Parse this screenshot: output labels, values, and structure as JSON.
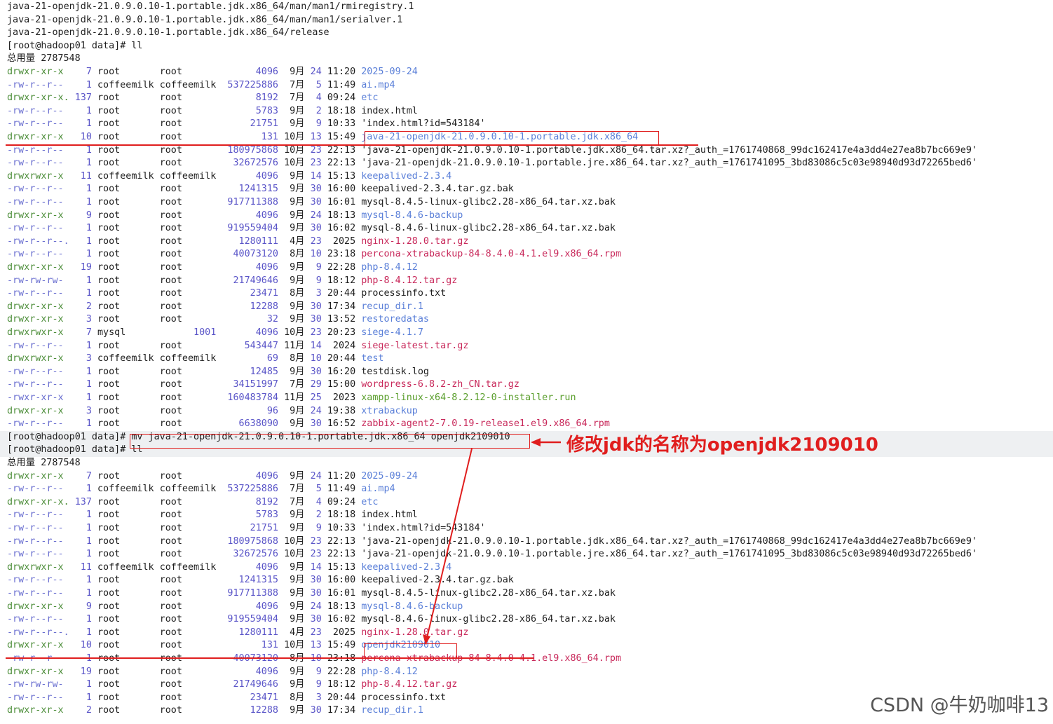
{
  "terminal": {
    "header_lines": [
      "java-21-openjdk-21.0.9.0.10-1.portable.jdk.x86_64/man/man1/rmiregistry.1",
      "java-21-openjdk-21.0.9.0.10-1.portable.jdk.x86_64/man/man1/serialver.1",
      "java-21-openjdk-21.0.9.0.10-1.portable.jdk.x86_64/release"
    ],
    "prompt1": "[root@hadoop01 data]#",
    "cmd1": " ll",
    "total1": "总用量 2787548",
    "listing1": [
      {
        "perm": "drwxr-xr-x ",
        "links": "  7",
        "user": "root      ",
        "group": "root      ",
        "size": "      4096",
        "mon": " 9月",
        "day": "24",
        "time": "11:20",
        "name": "2025-09-24",
        "cls": "c-dir"
      },
      {
        "perm": "-rw-r--r-- ",
        "links": "  1",
        "user": "coffeemilk",
        "group": "coffeemilk",
        "size": " 537225886",
        "mon": " 7月",
        "day": " 5",
        "time": "11:49",
        "name": "ai.mp4",
        "cls": "c-dir"
      },
      {
        "perm": "drwxr-xr-x.",
        "links": "137",
        "user": "root      ",
        "group": "root      ",
        "size": "      8192",
        "mon": " 7月",
        "day": " 4",
        "time": "09:24",
        "name": "etc",
        "cls": "c-dir"
      },
      {
        "perm": "-rw-r--r-- ",
        "links": "  1",
        "user": "root      ",
        "group": "root      ",
        "size": "      5783",
        "mon": " 9月",
        "day": " 2",
        "time": "18:18",
        "name": "index.html",
        "cls": "c-file"
      },
      {
        "perm": "-rw-r--r-- ",
        "links": "  1",
        "user": "root      ",
        "group": "root      ",
        "size": "     21751",
        "mon": " 9月",
        "day": " 9",
        "time": "10:33",
        "name": "'index.html?id=543184'",
        "cls": "c-file"
      },
      {
        "perm": "drwxr-xr-x ",
        "links": " 10",
        "user": "root      ",
        "group": "root      ",
        "size": "       131",
        "mon": "10月",
        "day": "13",
        "time": "15:49",
        "name": "java-21-openjdk-21.0.9.0.10-1.portable.jdk.x86_64",
        "cls": "c-dir"
      },
      {
        "perm": "-rw-r--r-- ",
        "links": "  1",
        "user": "root      ",
        "group": "root      ",
        "size": " 180975868",
        "mon": "10月",
        "day": "23",
        "time": "22:13",
        "name": "'java-21-openjdk-21.0.9.0.10-1.portable.jdk.x86_64.tar.xz?_auth_=1761740868_99dc162417e4a3dd4e27ea8b7bc669e9'",
        "cls": "c-file"
      },
      {
        "perm": "-rw-r--r-- ",
        "links": "  1",
        "user": "root      ",
        "group": "root      ",
        "size": "  32672576",
        "mon": "10月",
        "day": "23",
        "time": "22:13",
        "name": "'java-21-openjdk-21.0.9.0.10-1.portable.jre.x86_64.tar.xz?_auth_=1761741095_3bd83086c5c03e98940d93d72265bed6'",
        "cls": "c-file"
      },
      {
        "perm": "drwxrwxr-x ",
        "links": " 11",
        "user": "coffeemilk",
        "group": "coffeemilk",
        "size": "      4096",
        "mon": " 9月",
        "day": "14",
        "time": "15:13",
        "name": "keepalived-2.3.4",
        "cls": "c-dir"
      },
      {
        "perm": "-rw-r--r-- ",
        "links": "  1",
        "user": "root      ",
        "group": "root      ",
        "size": "   1241315",
        "mon": " 9月",
        "day": "30",
        "time": "16:00",
        "name": "keepalived-2.3.4.tar.gz.bak",
        "cls": "c-file"
      },
      {
        "perm": "-rw-r--r-- ",
        "links": "  1",
        "user": "root      ",
        "group": "root      ",
        "size": " 917711388",
        "mon": " 9月",
        "day": "30",
        "time": "16:01",
        "name": "mysql-8.4.5-linux-glibc2.28-x86_64.tar.xz.bak",
        "cls": "c-file"
      },
      {
        "perm": "drwxr-xr-x ",
        "links": "  9",
        "user": "root      ",
        "group": "root      ",
        "size": "      4096",
        "mon": " 9月",
        "day": "24",
        "time": "18:13",
        "name": "mysql-8.4.6-backup",
        "cls": "c-dir"
      },
      {
        "perm": "-rw-r--r-- ",
        "links": "  1",
        "user": "root      ",
        "group": "root      ",
        "size": " 919559404",
        "mon": " 9月",
        "day": "30",
        "time": "16:02",
        "name": "mysql-8.4.6-linux-glibc2.28-x86_64.tar.xz.bak",
        "cls": "c-file"
      },
      {
        "perm": "-rw-r--r--.",
        "links": "  1",
        "user": "root      ",
        "group": "root      ",
        "size": "   1280111",
        "mon": " 4月",
        "day": "23",
        "time": " 2025",
        "name": "nginx-1.28.0.tar.gz",
        "cls": "c-arch"
      },
      {
        "perm": "-rw-r--r-- ",
        "links": "  1",
        "user": "root      ",
        "group": "root      ",
        "size": "  40073120",
        "mon": " 8月",
        "day": "10",
        "time": "23:18",
        "name": "percona-xtrabackup-84-8.4.0-4.1.el9.x86_64.rpm",
        "cls": "c-arch"
      },
      {
        "perm": "drwxr-xr-x ",
        "links": " 19",
        "user": "root      ",
        "group": "root      ",
        "size": "      4096",
        "mon": " 9月",
        "day": " 9",
        "time": "22:28",
        "name": "php-8.4.12",
        "cls": "c-dir"
      },
      {
        "perm": "-rw-rw-rw- ",
        "links": "  1",
        "user": "root      ",
        "group": "root      ",
        "size": "  21749646",
        "mon": " 9月",
        "day": " 9",
        "time": "18:12",
        "name": "php-8.4.12.tar.gz",
        "cls": "c-arch"
      },
      {
        "perm": "-rw-r--r-- ",
        "links": "  1",
        "user": "root      ",
        "group": "root      ",
        "size": "     23471",
        "mon": " 8月",
        "day": " 3",
        "time": "20:44",
        "name": "processinfo.txt",
        "cls": "c-file"
      },
      {
        "perm": "drwxr-xr-x ",
        "links": "  2",
        "user": "root      ",
        "group": "root      ",
        "size": "     12288",
        "mon": " 9月",
        "day": "30",
        "time": "17:34",
        "name": "recup_dir.1",
        "cls": "c-dir"
      },
      {
        "perm": "drwxr-xr-x ",
        "links": "  3",
        "user": "root      ",
        "group": "root      ",
        "size": "        32",
        "mon": " 9月",
        "day": "30",
        "time": "13:52",
        "name": "restoredatas",
        "cls": "c-dir"
      },
      {
        "perm": "drwxrwxr-x ",
        "links": "  7",
        "user": "mysql     ",
        "group": "      1001",
        "size": "      4096",
        "mon": "10月",
        "day": "23",
        "time": "20:23",
        "name": "siege-4.1.7",
        "cls": "c-dir"
      },
      {
        "perm": "-rw-r--r-- ",
        "links": "  1",
        "user": "root      ",
        "group": "root      ",
        "size": "    543447",
        "mon": "11月",
        "day": "14",
        "time": " 2024",
        "name": "siege-latest.tar.gz",
        "cls": "c-arch"
      },
      {
        "perm": "drwxrwxr-x ",
        "links": "  3",
        "user": "coffeemilk",
        "group": "coffeemilk",
        "size": "        69",
        "mon": " 8月",
        "day": "10",
        "time": "20:44",
        "name": "test",
        "cls": "c-dir"
      },
      {
        "perm": "-rw-r--r-- ",
        "links": "  1",
        "user": "root      ",
        "group": "root      ",
        "size": "     12485",
        "mon": " 9月",
        "day": "30",
        "time": "16:20",
        "name": "testdisk.log",
        "cls": "c-file"
      },
      {
        "perm": "-rw-r--r-- ",
        "links": "  1",
        "user": "root      ",
        "group": "root      ",
        "size": "  34151997",
        "mon": " 7月",
        "day": "29",
        "time": "15:00",
        "name": "wordpress-6.8.2-zh_CN.tar.gz",
        "cls": "c-arch"
      },
      {
        "perm": "-rwxr-xr-x ",
        "links": "  1",
        "user": "root      ",
        "group": "root      ",
        "size": " 160483784",
        "mon": "11月",
        "day": "25",
        "time": " 2023",
        "name": "xampp-linux-x64-8.2.12-0-installer.run",
        "cls": "c-exec"
      },
      {
        "perm": "drwxr-xr-x ",
        "links": "  3",
        "user": "root      ",
        "group": "root      ",
        "size": "        96",
        "mon": " 9月",
        "day": "24",
        "time": "19:38",
        "name": "xtrabackup",
        "cls": "c-dir"
      },
      {
        "perm": "-rw-r--r-- ",
        "links": "  1",
        "user": "root      ",
        "group": "root      ",
        "size": "   6638090",
        "mon": " 9月",
        "day": "30",
        "time": "16:52",
        "name": "zabbix-agent2-7.0.19-release1.el9.x86_64.rpm",
        "cls": "c-arch"
      }
    ],
    "prompt2": "[root@hadoop01 data]#",
    "cmd2": " mv java-21-openjdk-21.0.9.0.10-1.portable.jdk.x86_64 openjdk2109010",
    "prompt3": "[root@hadoop01 data]#",
    "cmd3": " ll",
    "total2": "总用量 2787548",
    "listing2": [
      {
        "perm": "drwxr-xr-x ",
        "links": "  7",
        "user": "root      ",
        "group": "root      ",
        "size": "      4096",
        "mon": " 9月",
        "day": "24",
        "time": "11:20",
        "name": "2025-09-24",
        "cls": "c-dir"
      },
      {
        "perm": "-rw-r--r-- ",
        "links": "  1",
        "user": "coffeemilk",
        "group": "coffeemilk",
        "size": " 537225886",
        "mon": " 7月",
        "day": " 5",
        "time": "11:49",
        "name": "ai.mp4",
        "cls": "c-dir"
      },
      {
        "perm": "drwxr-xr-x.",
        "links": "137",
        "user": "root      ",
        "group": "root      ",
        "size": "      8192",
        "mon": " 7月",
        "day": " 4",
        "time": "09:24",
        "name": "etc",
        "cls": "c-dir"
      },
      {
        "perm": "-rw-r--r-- ",
        "links": "  1",
        "user": "root      ",
        "group": "root      ",
        "size": "      5783",
        "mon": " 9月",
        "day": " 2",
        "time": "18:18",
        "name": "index.html",
        "cls": "c-file"
      },
      {
        "perm": "-rw-r--r-- ",
        "links": "  1",
        "user": "root      ",
        "group": "root      ",
        "size": "     21751",
        "mon": " 9月",
        "day": " 9",
        "time": "10:33",
        "name": "'index.html?id=543184'",
        "cls": "c-file"
      },
      {
        "perm": "-rw-r--r-- ",
        "links": "  1",
        "user": "root      ",
        "group": "root      ",
        "size": " 180975868",
        "mon": "10月",
        "day": "23",
        "time": "22:13",
        "name": "'java-21-openjdk-21.0.9.0.10-1.portable.jdk.x86_64.tar.xz?_auth_=1761740868_99dc162417e4a3dd4e27ea8b7bc669e9'",
        "cls": "c-file"
      },
      {
        "perm": "-rw-r--r-- ",
        "links": "  1",
        "user": "root      ",
        "group": "root      ",
        "size": "  32672576",
        "mon": "10月",
        "day": "23",
        "time": "22:13",
        "name": "'java-21-openjdk-21.0.9.0.10-1.portable.jre.x86_64.tar.xz?_auth_=1761741095_3bd83086c5c03e98940d93d72265bed6'",
        "cls": "c-file"
      },
      {
        "perm": "drwxrwxr-x ",
        "links": " 11",
        "user": "coffeemilk",
        "group": "coffeemilk",
        "size": "      4096",
        "mon": " 9月",
        "day": "14",
        "time": "15:13",
        "name": "keepalived-2.3.4",
        "cls": "c-dir"
      },
      {
        "perm": "-rw-r--r-- ",
        "links": "  1",
        "user": "root      ",
        "group": "root      ",
        "size": "   1241315",
        "mon": " 9月",
        "day": "30",
        "time": "16:00",
        "name": "keepalived-2.3.4.tar.gz.bak",
        "cls": "c-file"
      },
      {
        "perm": "-rw-r--r-- ",
        "links": "  1",
        "user": "root      ",
        "group": "root      ",
        "size": " 917711388",
        "mon": " 9月",
        "day": "30",
        "time": "16:01",
        "name": "mysql-8.4.5-linux-glibc2.28-x86_64.tar.xz.bak",
        "cls": "c-file"
      },
      {
        "perm": "drwxr-xr-x ",
        "links": "  9",
        "user": "root      ",
        "group": "root      ",
        "size": "      4096",
        "mon": " 9月",
        "day": "24",
        "time": "18:13",
        "name": "mysql-8.4.6-backup",
        "cls": "c-dir"
      },
      {
        "perm": "-rw-r--r-- ",
        "links": "  1",
        "user": "root      ",
        "group": "root      ",
        "size": " 919559404",
        "mon": " 9月",
        "day": "30",
        "time": "16:02",
        "name": "mysql-8.4.6-linux-glibc2.28-x86_64.tar.xz.bak",
        "cls": "c-file"
      },
      {
        "perm": "-rw-r--r--.",
        "links": "  1",
        "user": "root      ",
        "group": "root      ",
        "size": "   1280111",
        "mon": " 4月",
        "day": "23",
        "time": " 2025",
        "name": "nginx-1.28.0.tar.gz",
        "cls": "c-arch"
      },
      {
        "perm": "drwxr-xr-x ",
        "links": " 10",
        "user": "root      ",
        "group": "root      ",
        "size": "       131",
        "mon": "10月",
        "day": "13",
        "time": "15:49",
        "name": "openjdk2109010",
        "cls": "c-dir"
      },
      {
        "perm": "-rw-r--r-- ",
        "links": "  1",
        "user": "root      ",
        "group": "root      ",
        "size": "  40073120",
        "mon": " 8月",
        "day": "10",
        "time": "23:18",
        "name": "percona-xtrabackup-84-8.4.0-4.1.el9.x86_64.rpm",
        "cls": "c-arch"
      },
      {
        "perm": "drwxr-xr-x ",
        "links": " 19",
        "user": "root      ",
        "group": "root      ",
        "size": "      4096",
        "mon": " 9月",
        "day": " 9",
        "time": "22:28",
        "name": "php-8.4.12",
        "cls": "c-dir"
      },
      {
        "perm": "-rw-rw-rw- ",
        "links": "  1",
        "user": "root      ",
        "group": "root      ",
        "size": "  21749646",
        "mon": " 9月",
        "day": " 9",
        "time": "18:12",
        "name": "php-8.4.12.tar.gz",
        "cls": "c-arch"
      },
      {
        "perm": "-rw-r--r-- ",
        "links": "  1",
        "user": "root      ",
        "group": "root      ",
        "size": "     23471",
        "mon": " 8月",
        "day": " 3",
        "time": "20:44",
        "name": "processinfo.txt",
        "cls": "c-file"
      },
      {
        "perm": "drwxr-xr-x ",
        "links": "  2",
        "user": "root      ",
        "group": "root      ",
        "size": "     12288",
        "mon": " 9月",
        "day": "30",
        "time": "17:34",
        "name": "recup_dir.1",
        "cls": "c-dir"
      }
    ]
  },
  "annotation": "修改jdk的名称为openjdk2109010",
  "watermark": "CSDN @牛奶咖啡13",
  "colors": {
    "accent": "#e01e1e",
    "dir": "#5a7fd8",
    "archive": "#c8285a",
    "exec": "#5a9e2c",
    "perm": "#4d8e3a"
  }
}
